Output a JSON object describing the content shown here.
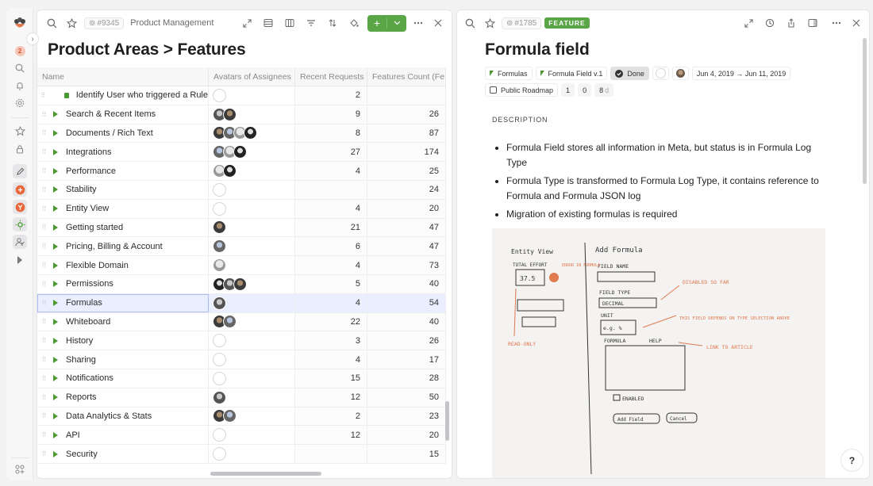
{
  "rail": {
    "notification_count": "2"
  },
  "left": {
    "item_id": "#9345",
    "breadcrumb": "Product Management",
    "title": "Product Areas > Features",
    "add_label": "+",
    "columns": [
      "Name",
      "Avatars of Assignees",
      "Recent Requests",
      "Features Count (Fe"
    ],
    "rows": [
      {
        "name": "Identify User who triggered a Rule",
        "type": "leaf",
        "avatars": 0,
        "requests": "2",
        "count": ""
      },
      {
        "name": "Search & Recent Items",
        "type": "group",
        "avatars": 2,
        "requests": "9",
        "count": "26"
      },
      {
        "name": "Documents / Rich Text",
        "type": "group",
        "avatars": 4,
        "requests": "8",
        "count": "87"
      },
      {
        "name": "Integrations",
        "type": "group",
        "avatars": 3,
        "requests": "27",
        "count": "174"
      },
      {
        "name": "Performance",
        "type": "group",
        "avatars": 2,
        "requests": "4",
        "count": "25"
      },
      {
        "name": "Stability",
        "type": "group",
        "avatars": 0,
        "requests": "",
        "count": "24"
      },
      {
        "name": "Entity View",
        "type": "group",
        "avatars": 0,
        "requests": "4",
        "count": "20"
      },
      {
        "name": "Getting started",
        "type": "group",
        "avatars": 1,
        "requests": "21",
        "count": "47"
      },
      {
        "name": "Pricing, Billing & Account",
        "type": "group",
        "avatars": 1,
        "requests": "6",
        "count": "47"
      },
      {
        "name": "Flexible Domain",
        "type": "group",
        "avatars": 1,
        "requests": "4",
        "count": "73"
      },
      {
        "name": "Permissions",
        "type": "group",
        "avatars": 3,
        "requests": "5",
        "count": "40"
      },
      {
        "name": "Formulas",
        "type": "group",
        "avatars": 1,
        "requests": "4",
        "count": "54",
        "selected": true
      },
      {
        "name": "Whiteboard",
        "type": "group",
        "avatars": 2,
        "requests": "22",
        "count": "40"
      },
      {
        "name": "History",
        "type": "group",
        "avatars": 0,
        "requests": "3",
        "count": "26"
      },
      {
        "name": "Sharing",
        "type": "group",
        "avatars": 0,
        "requests": "4",
        "count": "17"
      },
      {
        "name": "Notifications",
        "type": "group",
        "avatars": 0,
        "requests": "15",
        "count": "28"
      },
      {
        "name": "Reports",
        "type": "group",
        "avatars": 1,
        "requests": "12",
        "count": "50"
      },
      {
        "name": "Data Analytics & Stats",
        "type": "group",
        "avatars": 2,
        "requests": "2",
        "count": "23"
      },
      {
        "name": "API",
        "type": "group",
        "avatars": 0,
        "requests": "12",
        "count": "20"
      },
      {
        "name": "Security",
        "type": "group",
        "avatars": 0,
        "requests": "",
        "count": "15"
      }
    ]
  },
  "right": {
    "item_id": "#1785",
    "entity_type": "FEATURE",
    "title": "Formula field",
    "chips": {
      "product_area": "Formulas",
      "release": "Formula Field v.1",
      "state": "Done",
      "dates": "Jun 4, 2019 → Jun 11, 2019",
      "roadmap": "Public Roadmap",
      "count_a": "1",
      "count_b": "0",
      "duration": "8",
      "duration_unit": "d"
    },
    "description_label": "DESCRIPTION",
    "bullets": [
      "Formula Field stores all information in Meta, but status is in Formula Log Type",
      "Formula Type is transformed to Formula Log Type, it contains reference to Formula and Formula JSON log",
      "Migration of existing formulas is required"
    ],
    "sketch": {
      "left_title": "Entity View",
      "right_title": "Add Formula",
      "total_effort": "TOTAL EFFORT",
      "effort_value": "37.5",
      "field_name": "FIELD NAME",
      "field_type": "FIELD TYPE",
      "decimal": "DECIMAL",
      "unit": "UNIT",
      "unit_value": "e.g. %",
      "formula": "FORMULA",
      "help": "HELP",
      "enabled": "ENABLED",
      "add_field": "Add Field",
      "cancel": "Cancel",
      "note_error": "ERROR IN FORMULA",
      "note_disabled": "DISABLED SO FAR",
      "note_depends": "THIS FIELD DEPENDS ON TYPE SELECTION ABOVE",
      "note_link": "LINK TO ARTICLE",
      "note_readonly": "READ-ONLY"
    }
  },
  "help_label": "?",
  "colors": {
    "accent_green": "#5aa546",
    "selection": "#eaefff",
    "sketch_orange": "#e07a4f"
  }
}
